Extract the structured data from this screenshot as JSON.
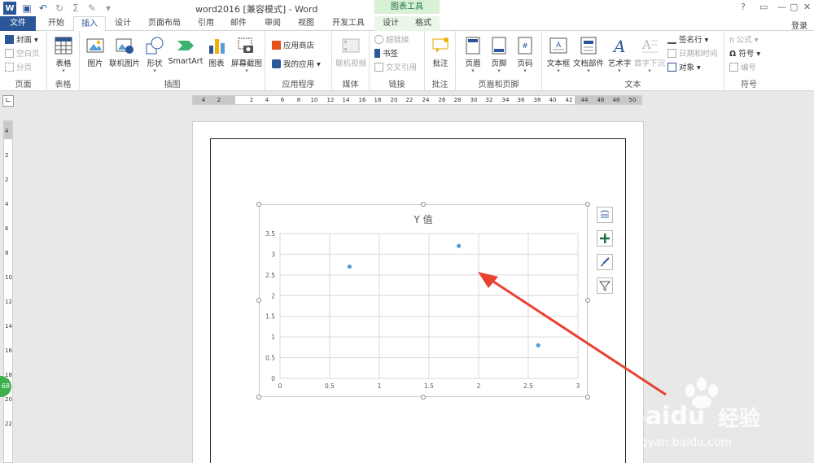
{
  "window": {
    "title": "word2016 [兼容模式] - Word",
    "context_tab_header": "图表工具",
    "controls": [
      "?",
      "▭",
      "—",
      "▢",
      "✕"
    ]
  },
  "tabs": [
    "文件",
    "开始",
    "插入",
    "设计",
    "页面布局",
    "引用",
    "邮件",
    "审阅",
    "视图",
    "开发工具",
    "设计",
    "格式"
  ],
  "active_tab": "插入",
  "login_label": "登录",
  "ribbon": {
    "pages": {
      "label": "页面",
      "cover": "封面",
      "blank": "空白页",
      "break": "分页"
    },
    "tables": {
      "label": "表格",
      "table": "表格"
    },
    "illustrations": {
      "label": "插图",
      "picture": "图片",
      "online_picture": "联机图片",
      "shapes": "形状",
      "smartart": "SmartArt",
      "chart": "图表",
      "screenshot": "屏幕截图"
    },
    "apps": {
      "label": "应用程序",
      "store": "应用商店",
      "my_apps": "我的应用"
    },
    "media": {
      "label": "媒体",
      "online_video": "联机视频"
    },
    "links": {
      "label": "链接",
      "hyperlink": "超链接",
      "bookmark": "书签",
      "cross_ref": "交叉引用"
    },
    "comments": {
      "label": "批注",
      "comment": "批注"
    },
    "header_footer": {
      "label": "页眉和页脚",
      "header": "页眉",
      "footer": "页脚",
      "page_number": "页码"
    },
    "text": {
      "label": "文本",
      "textbox": "文本框",
      "quick_parts": "文档部件",
      "wordart": "艺术字",
      "dropcap": "首字下沉",
      "signature": "签名行",
      "datetime": "日期和时间",
      "object": "对象"
    },
    "symbols": {
      "label": "符号",
      "equation": "公式",
      "symbol": "符号",
      "number": "编号"
    }
  },
  "ruler": {
    "h_ticks": [
      "4",
      "2",
      "2",
      "4",
      "6",
      "8",
      "10",
      "12",
      "14",
      "16",
      "18",
      "20",
      "22",
      "24",
      "26",
      "28",
      "30",
      "32",
      "34",
      "36",
      "38",
      "40",
      "42",
      "44",
      "46",
      "48",
      "50"
    ],
    "v_ticks": [
      "4",
      "2",
      "2",
      "4",
      "6",
      "8",
      "10",
      "12",
      "14",
      "16",
      "18",
      "20",
      "22"
    ]
  },
  "chart_data": {
    "type": "scatter",
    "title": "Y 值",
    "xlim": [
      0,
      3
    ],
    "ylim": [
      0,
      3.5
    ],
    "x_ticks": [
      "0",
      "0.5",
      "1",
      "1.5",
      "2",
      "2.5",
      "3"
    ],
    "y_ticks": [
      "0",
      "0.5",
      "1",
      "1.5",
      "2",
      "2.5",
      "3",
      "3.5"
    ],
    "grid": true,
    "legend": "none",
    "series": [
      {
        "points": [
          {
            "x": 0.7,
            "y": 2.7
          },
          {
            "x": 1.8,
            "y": 3.2
          },
          {
            "x": 2.6,
            "y": 0.8
          }
        ]
      }
    ],
    "marker_color": "#5b9bd5"
  },
  "watermark": {
    "brand": "Baidu",
    "brand2": "经验",
    "url": "jingyan.baidu.com"
  },
  "badge_number": "68"
}
